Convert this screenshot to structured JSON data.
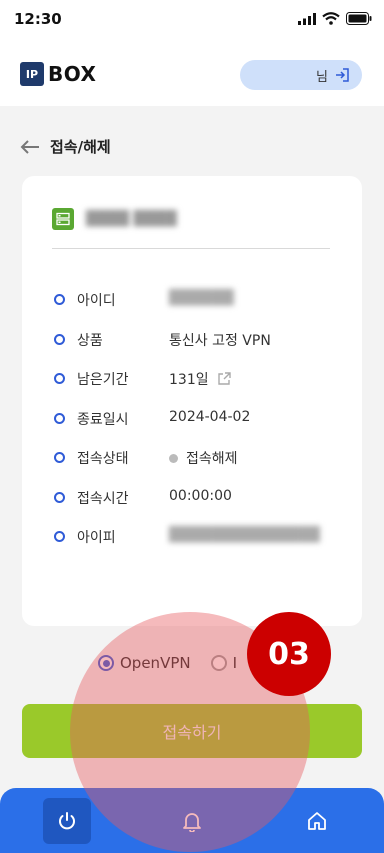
{
  "status_bar": {
    "time": "12:30"
  },
  "header": {
    "logo_mark": "IP",
    "logo_text": "BOX",
    "user_suffix": "님"
  },
  "page": {
    "title": "접속/해제"
  },
  "card": {
    "server_name": "████ ████",
    "rows": [
      {
        "label": "아이디",
        "value": "██████"
      },
      {
        "label": "상품",
        "value": "통신사 고정 VPN"
      },
      {
        "label": "남은기간",
        "value": "131일"
      },
      {
        "label": "종료일시",
        "value": "2024-04-02"
      },
      {
        "label": "접속상태",
        "value": "접속해제"
      },
      {
        "label": "접속시간",
        "value": "00:00:00"
      },
      {
        "label": "아이피",
        "value": "██████████████"
      }
    ]
  },
  "protocols": {
    "option1": "OpenVPN",
    "option2": "I"
  },
  "connect_button": "접속하기",
  "annotation": {
    "step": "03"
  },
  "colors": {
    "accent": "#2f5bd7",
    "button": "#9ac92a",
    "nav": "#2b6fe8",
    "badge": "#cc0000"
  }
}
